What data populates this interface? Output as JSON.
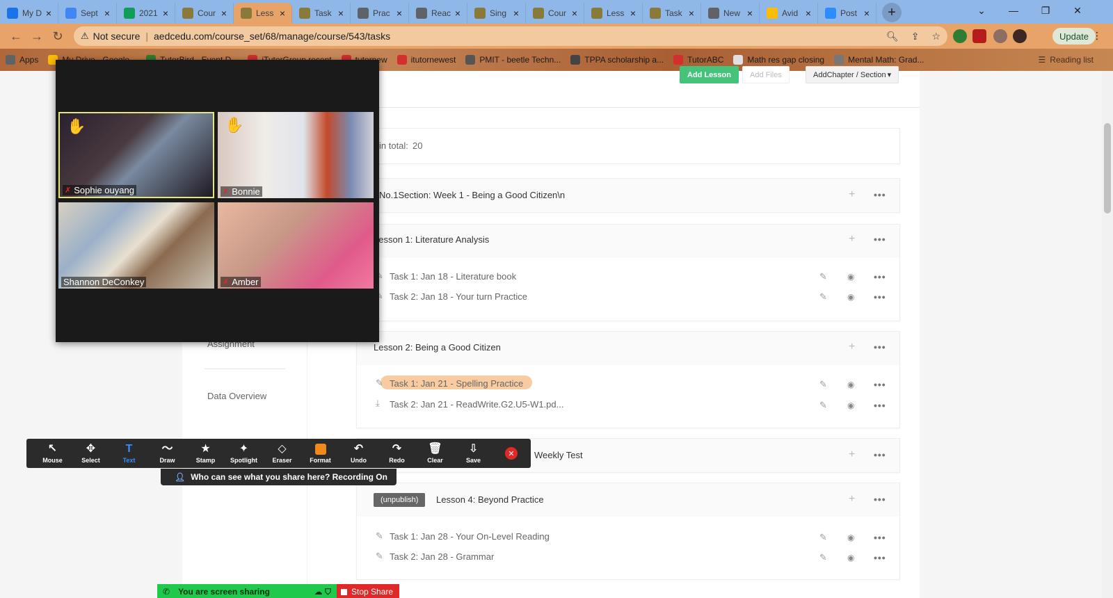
{
  "browser": {
    "tabs": [
      {
        "label": "My D",
        "favicon_color": "#1a73e8",
        "favicon_icon": "drive-icon"
      },
      {
        "label": "Sept",
        "favicon_color": "#4285f4",
        "favicon_icon": "docs-icon"
      },
      {
        "label": "2021",
        "favicon_color": "#0f9d58",
        "favicon_icon": "sheets-icon"
      },
      {
        "label": "Cour",
        "favicon_color": "#8a7a3a",
        "favicon_icon": "course-icon"
      },
      {
        "label": "Less",
        "favicon_color": "#8a7a3a",
        "favicon_icon": "course-icon"
      },
      {
        "label": "Task",
        "favicon_color": "#8a7a3a",
        "favicon_icon": "course-icon"
      },
      {
        "label": "Prac",
        "favicon_color": "#5f6368",
        "favicon_icon": "globe-icon"
      },
      {
        "label": "Reac",
        "favicon_color": "#5f6368",
        "favicon_icon": "globe-icon"
      },
      {
        "label": "Sing",
        "favicon_color": "#8a7a3a",
        "favicon_icon": "course-icon"
      },
      {
        "label": "Cour",
        "favicon_color": "#8a7a3a",
        "favicon_icon": "course-icon"
      },
      {
        "label": "Less",
        "favicon_color": "#8a7a3a",
        "favicon_icon": "course-icon"
      },
      {
        "label": "Task",
        "favicon_color": "#8a7a3a",
        "favicon_icon": "course-icon"
      },
      {
        "label": "New",
        "favicon_color": "#5f6368",
        "favicon_icon": "chrome-icon"
      },
      {
        "label": "Avid",
        "favicon_color": "#fbbc04",
        "favicon_icon": "drive-icon"
      },
      {
        "label": "Post",
        "favicon_color": "#2d8cff",
        "favicon_icon": "zoom-icon"
      }
    ],
    "active_tab_index": 4,
    "omnibox": {
      "security": "Not secure",
      "url": "aedcedu.com/course_set/68/manage/course/543/tasks"
    },
    "update_label": "Update",
    "bookmarks": [
      {
        "label": "Apps",
        "color": "#5f6368"
      },
      {
        "label": "My Drive - Google...",
        "color": "#fbbc04"
      },
      {
        "label": "TutorBird - Event D...",
        "color": "#2e7d32"
      },
      {
        "label": "iTutorGroup recent",
        "color": "#d32f2f"
      },
      {
        "label": "tutornew",
        "color": "#d32f2f"
      },
      {
        "label": "itutornewest",
        "color": "#d32f2f"
      },
      {
        "label": "PMIT - beetle Techn...",
        "color": "#555555"
      },
      {
        "label": "TPPA scholarship a...",
        "color": "#444444"
      },
      {
        "label": "TutorABC",
        "color": "#d32f2f"
      },
      {
        "label": "Math res gap closing",
        "color": "#e0e0e0"
      },
      {
        "label": "Mental Math: Grad...",
        "color": "#777777"
      }
    ],
    "reading_list": "Reading list"
  },
  "sidebar": {
    "items": [
      "Assignment",
      "Data Overview"
    ]
  },
  "course": {
    "total_label": "in total:",
    "total_value": "20",
    "add_lesson": "Add Lesson",
    "add_files": "Add Files",
    "add_chapter": "AddChapter / Section",
    "section": "No.1Section:  Week 1 - Being a Good Citizen\\n",
    "lessons": [
      {
        "title": "Lesson 1:   Literature Analysis",
        "tasks": [
          "Task 1:   Jan 18 - Literature book",
          "Task 2:   Jan 18 - Your turn Practice"
        ]
      },
      {
        "title": "Lesson 2:   Being a Good Citizen",
        "tasks": [
          "Task 1:   Jan 21 - Spelling Practice",
          "Task 2:   Jan 21 - ReadWrite.G2.U5-W1.pd..."
        ]
      },
      {
        "title": "Weekly Test",
        "tasks": []
      },
      {
        "title": "Lesson 4:   Beyond Practice",
        "badge": "(unpublish)",
        "tasks": [
          "Task 1:   Jan 28 - Your On-Level Reading",
          "Task 2:   Jan 28 - Grammar"
        ]
      }
    ]
  },
  "zoom": {
    "participants": [
      "Sophie ouyang",
      "Bonnie",
      "Shannon DeConkey",
      "Amber"
    ],
    "annotate_tools": [
      {
        "label": "Mouse",
        "icon": "pointer-icon"
      },
      {
        "label": "Select",
        "icon": "select-icon"
      },
      {
        "label": "Text",
        "icon": "text-icon"
      },
      {
        "label": "Draw",
        "icon": "draw-icon"
      },
      {
        "label": "Stamp",
        "icon": "stamp-icon"
      },
      {
        "label": "Spotlight",
        "icon": "spotlight-icon"
      },
      {
        "label": "Eraser",
        "icon": "eraser-icon"
      },
      {
        "label": "Format",
        "icon": "format-icon"
      },
      {
        "label": "Undo",
        "icon": "undo-icon"
      },
      {
        "label": "Redo",
        "icon": "redo-icon"
      },
      {
        "label": "Clear",
        "icon": "trash-icon"
      },
      {
        "label": "Save",
        "icon": "save-icon"
      }
    ],
    "active_tool": "Text",
    "who_sees": "Who can see what you share here? Recording On",
    "sharing_label": "You are screen sharing",
    "stop_share": "Stop Share"
  },
  "colors": {
    "tab_active": "#e8a468",
    "accent_green": "#46c37b",
    "share_green": "#1ec94b",
    "stop_red": "#e02828"
  }
}
